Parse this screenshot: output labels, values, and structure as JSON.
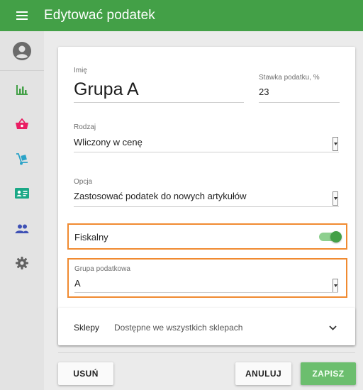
{
  "header": {
    "title": "Edytować podatek",
    "menu_icon": "hamburger-menu-icon"
  },
  "sidebar": {
    "avatar_icon": "account-circle-icon",
    "items": [
      {
        "icon": "bar-chart-icon",
        "color": "#43a047"
      },
      {
        "icon": "shopping-basket-icon",
        "color": "#e91e63"
      },
      {
        "icon": "hand-truck-icon",
        "color": "#2aa3c8"
      },
      {
        "icon": "id-card-icon",
        "color": "#1aa886"
      },
      {
        "icon": "people-icon",
        "color": "#3f51b5"
      },
      {
        "icon": "gear-icon",
        "color": "#616161"
      }
    ]
  },
  "form": {
    "name": {
      "label": "Imię",
      "value": "Grupa A"
    },
    "rate": {
      "label": "Stawka podatku, %",
      "value": "23"
    },
    "type": {
      "label": "Rodzaj",
      "value": "Wliczony w cenę"
    },
    "option": {
      "label": "Opcja",
      "value": "Zastosować podatek do nowych artykułów"
    },
    "fiscal": {
      "label": "Fiskalny",
      "enabled": true
    },
    "tax_group": {
      "label": "Grupa podatkowa",
      "value": "A"
    },
    "stores": {
      "label": "Sklepy",
      "value": "Dostępne we wszystkich sklepach"
    }
  },
  "actions": {
    "delete": "USUŃ",
    "cancel": "ANULUJ",
    "save": "ZAPISZ"
  },
  "colors": {
    "primary": "#43a047",
    "highlight": "#f08a30",
    "save_button": "#6cbe6e"
  }
}
